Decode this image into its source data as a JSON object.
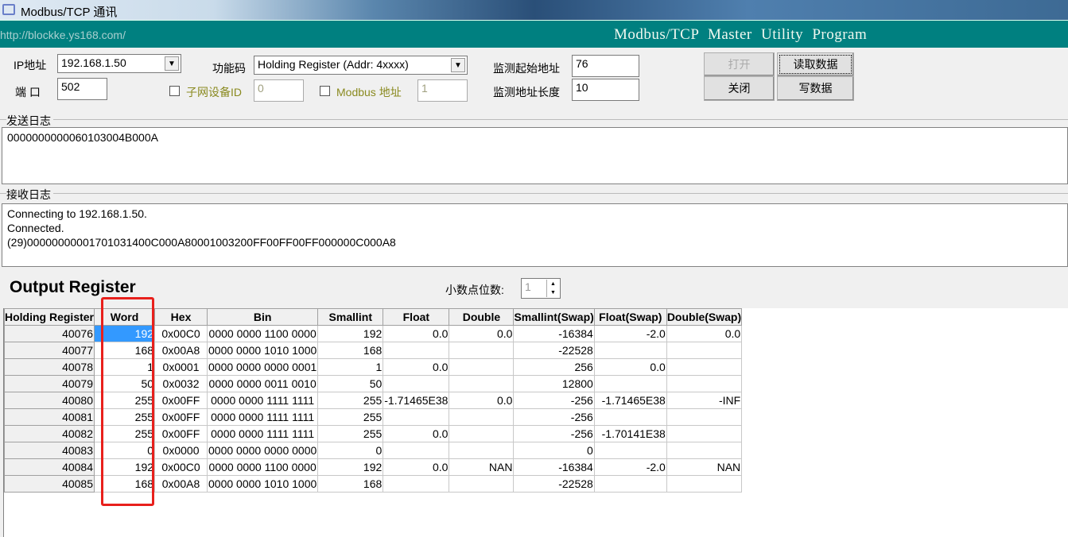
{
  "window": {
    "title": "Modbus/TCP 通讯",
    "url": "http://blockke.ys168.com/",
    "program_title": "Modbus/TCP  Master Utility Program"
  },
  "controls": {
    "ip_label": "IP地址",
    "ip_value": "192.168.1.50",
    "port_label": "端 口",
    "port_value": "502",
    "function_label": "功能码",
    "function_value": "Holding Register (Addr: 4xxxx)",
    "subnet_label": "子网设备ID",
    "subnet_value": "0",
    "subnet_checked": false,
    "modbus_addr_label": "Modbus 地址",
    "modbus_addr_value": "1",
    "modbus_addr_checked": false,
    "start_addr_label": "监测起始地址",
    "start_addr_value": "76",
    "length_label": "监测地址长度",
    "length_value": "10",
    "open_button": "打开",
    "close_button": "关闭",
    "read_button": "读取数据",
    "write_button": "写数据"
  },
  "send_log": {
    "label": "发送日志",
    "lines": [
      "0000000000060103004B000A"
    ]
  },
  "recv_log": {
    "label": "接收日志",
    "lines": [
      "Connecting to 192.168.1.50.",
      "Connected.",
      "(29)00000000001701031400C000A80001003200FF00FF00FF000000C000A8"
    ]
  },
  "output": {
    "title": "Output Register",
    "decimal_label": "小数点位数:",
    "decimal_value": "1",
    "columns": [
      "Holding Register",
      "Word",
      "Hex",
      "Bin",
      "Smallint",
      "Float",
      "Double",
      "Smallint(Swap)",
      "Float(Swap)",
      "Double(Swap)"
    ],
    "rows": [
      [
        "40076",
        "192",
        "0x00C0",
        "0000 0000 1100 0000",
        "192",
        "0.0",
        "0.0",
        "-16384",
        "-2.0",
        "0.0"
      ],
      [
        "40077",
        "168",
        "0x00A8",
        "0000 0000 1010 1000",
        "168",
        "",
        "",
        "-22528",
        "",
        ""
      ],
      [
        "40078",
        "1",
        "0x0001",
        "0000 0000 0000 0001",
        "1",
        "0.0",
        "",
        "256",
        "0.0",
        ""
      ],
      [
        "40079",
        "50",
        "0x0032",
        "0000 0000 0011 0010",
        "50",
        "",
        "",
        "12800",
        "",
        ""
      ],
      [
        "40080",
        "255",
        "0x00FF",
        "0000 0000 1111 1111",
        "255",
        "-1.71465E38",
        "0.0",
        "-256",
        "-1.71465E38",
        "-INF"
      ],
      [
        "40081",
        "255",
        "0x00FF",
        "0000 0000 1111 1111",
        "255",
        "",
        "",
        "-256",
        "",
        ""
      ],
      [
        "40082",
        "255",
        "0x00FF",
        "0000 0000 1111 1111",
        "255",
        "0.0",
        "",
        "-256",
        "-1.70141E38",
        ""
      ],
      [
        "40083",
        "0",
        "0x0000",
        "0000 0000 0000 0000",
        "0",
        "",
        "",
        "0",
        "",
        ""
      ],
      [
        "40084",
        "192",
        "0x00C0",
        "0000 0000 1100 0000",
        "192",
        "0.0",
        "NAN",
        "-16384",
        "-2.0",
        "NAN"
      ],
      [
        "40085",
        "168",
        "0x00A8",
        "0000 0000 1010 1000",
        "168",
        "",
        "",
        "-22528",
        "",
        ""
      ]
    ]
  },
  "colors": {
    "banner": "#008080",
    "highlight": "#e8201c",
    "selection": "#3399ff"
  }
}
